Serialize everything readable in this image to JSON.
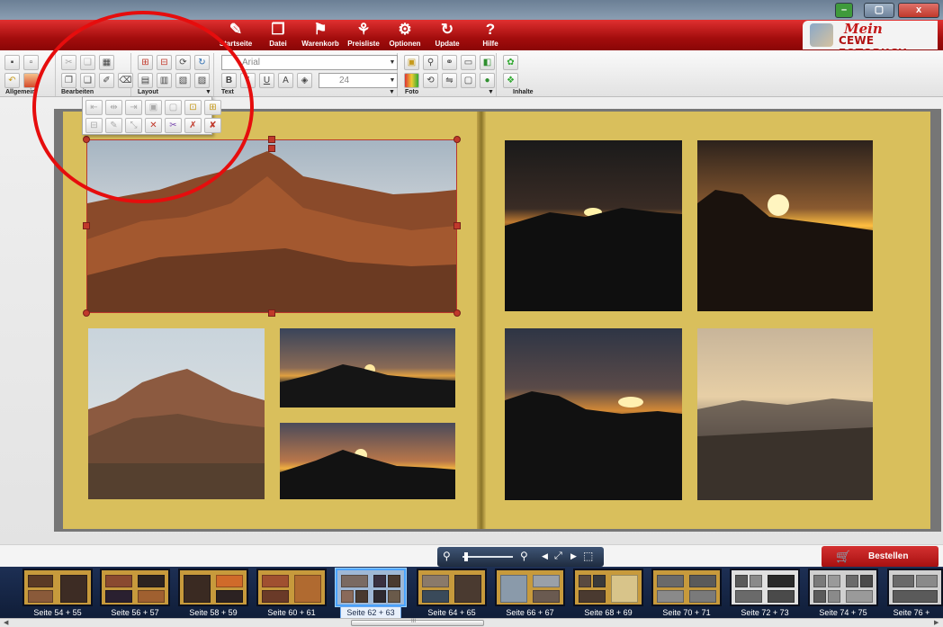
{
  "window": {
    "minimize_label": "–",
    "maximize_label": "▢",
    "close_label": "x"
  },
  "menu": {
    "items": [
      {
        "label": "Startseite",
        "icon": "home-icon",
        "glyph": "✎"
      },
      {
        "label": "Datei",
        "icon": "file-icon",
        "glyph": "❐"
      },
      {
        "label": "Warenkorb",
        "icon": "cart-icon",
        "glyph": "🛒"
      },
      {
        "label": "Preisliste",
        "icon": "pricelist-icon",
        "glyph": "💲"
      },
      {
        "label": "Optionen",
        "icon": "gears-icon",
        "glyph": "⚙"
      },
      {
        "label": "Update",
        "icon": "update-icon",
        "glyph": "↻"
      },
      {
        "label": "Hilfe",
        "icon": "help-icon",
        "glyph": "?"
      }
    ]
  },
  "logo": {
    "mein": "Mein",
    "brand": "CEWE FOTOBUCH"
  },
  "toolbar": {
    "groups": {
      "allgemein": "Allgemein",
      "bearbeiten": "Bearbeiten",
      "layout": "Layout",
      "text": "Text",
      "foto": "Foto",
      "inhalte": "Inhalte"
    },
    "font_name": "Arial",
    "font_size": "24"
  },
  "zoom": {
    "zoom_out_icon": "zoom-out-icon",
    "zoom_in_icon": "zoom-in-icon"
  },
  "order_button": {
    "label": "Bestellen"
  },
  "filmstrip": {
    "pages": [
      {
        "label": "Seite 54 + 55",
        "selected": false
      },
      {
        "label": "Seite 56 + 57",
        "selected": false
      },
      {
        "label": "Seite 58 + 59",
        "selected": false
      },
      {
        "label": "Seite 60 + 61",
        "selected": false
      },
      {
        "label": "Seite 62 + 63",
        "selected": true
      },
      {
        "label": "Seite 64 + 65",
        "selected": false
      },
      {
        "label": "Seite 66 + 67",
        "selected": false
      },
      {
        "label": "Seite 68 + 69",
        "selected": false
      },
      {
        "label": "Seite 70 + 71",
        "selected": false
      },
      {
        "label": "Seite 72 + 73",
        "selected": false
      },
      {
        "label": "Seite 74 + 75",
        "selected": false
      },
      {
        "label": "Seite 76 +",
        "selected": false
      }
    ]
  },
  "scrollbar": {
    "grip": "III"
  },
  "colors": {
    "menu_red": "#b31212",
    "page_gold": "#d9bf5c",
    "annotation_red": "#e60d0d",
    "filmstrip_blue": "#152545"
  }
}
